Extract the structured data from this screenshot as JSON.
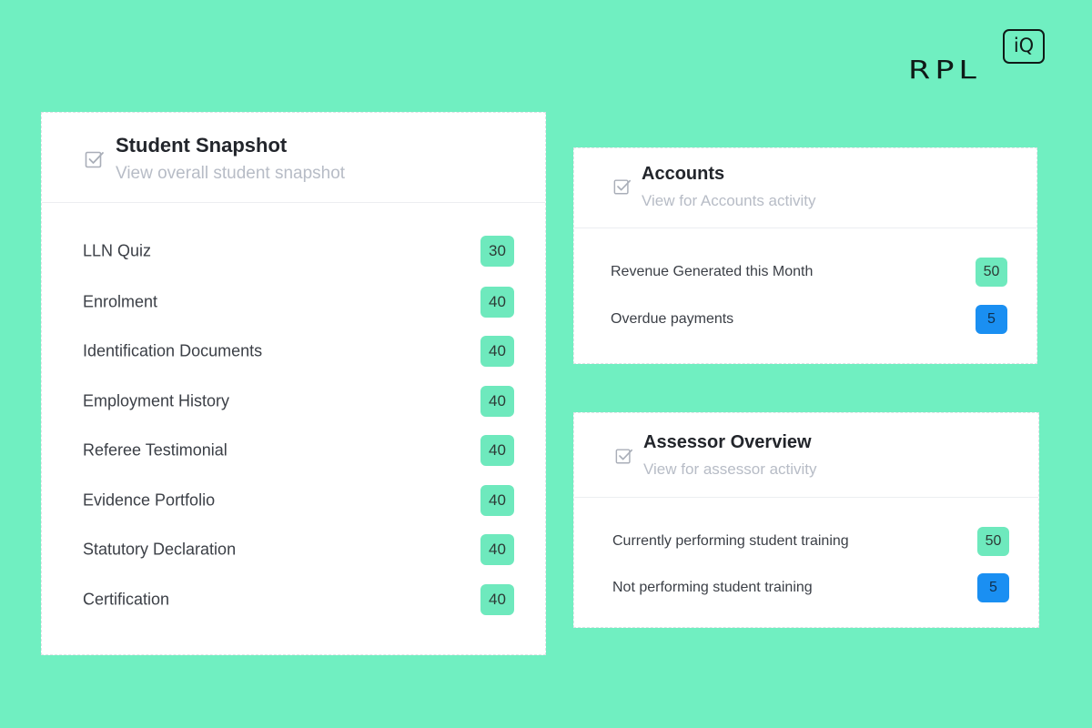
{
  "logo": {
    "text": "RPL",
    "badge": "iQ"
  },
  "student_snapshot": {
    "title": "Student Snapshot",
    "subtitle": "View overall student snapshot",
    "icon": "checkbox-icon",
    "items": [
      {
        "label": "LLN Quiz",
        "count": "30"
      },
      {
        "label": "Enrolment",
        "count": "40"
      },
      {
        "label": "Identification Documents",
        "count": "40"
      },
      {
        "label": "Employment History",
        "count": "40"
      },
      {
        "label": "Referee Testimonial",
        "count": "40"
      },
      {
        "label": "Evidence Portfolio",
        "count": "40"
      },
      {
        "label": "Statutory Declaration",
        "count": "40"
      },
      {
        "label": "Certification",
        "count": "40"
      }
    ]
  },
  "accounts": {
    "title": "Accounts",
    "subtitle": "View for Accounts activity",
    "icon": "checkbox-icon",
    "items": [
      {
        "label": "Revenue Generated this Month",
        "count": "50",
        "color": "#6ee9bd"
      },
      {
        "label": "Overdue payments",
        "count": "5",
        "color": "#1a8ff2"
      }
    ]
  },
  "assessor_overview": {
    "title": "Assessor Overview",
    "subtitle": "View for assessor activity",
    "icon": "checkbox-icon",
    "items": [
      {
        "label": "Currently performing student training",
        "count": "50",
        "color": "#6ee9bd"
      },
      {
        "label": "Not performing student training",
        "count": "5",
        "color": "#1a8ff2"
      }
    ]
  },
  "colors": {
    "background": "#70EFC1",
    "badge_green": "#6ee9bd",
    "badge_blue": "#1a8ff2"
  }
}
